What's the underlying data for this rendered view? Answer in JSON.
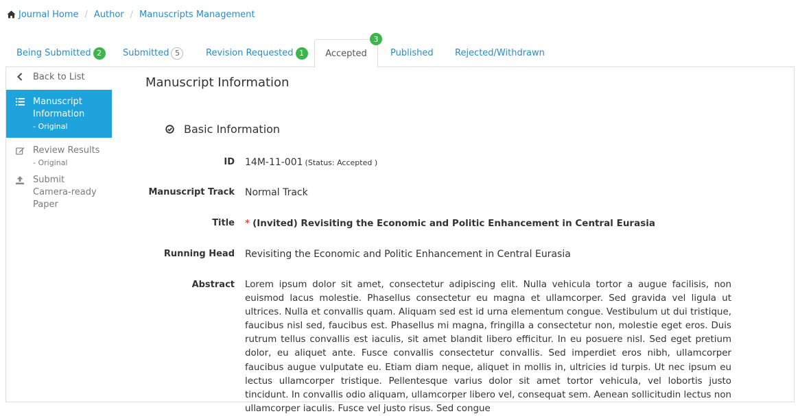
{
  "breadcrumb": {
    "items": [
      "Journal Home",
      "Author",
      "Manuscripts Management"
    ],
    "separator": "/"
  },
  "tabs": [
    {
      "label": "Being Submitted",
      "badge": "2",
      "badge_style": "green"
    },
    {
      "label": "Submitted",
      "badge": "5",
      "badge_style": "outline"
    },
    {
      "label": "Revision Requested",
      "badge": "1",
      "badge_style": "green"
    },
    {
      "label": "Accepted",
      "badge": "3",
      "badge_style": "green",
      "active": true
    },
    {
      "label": "Published"
    },
    {
      "label": "Rejected/Withdrawn"
    }
  ],
  "sidebar": {
    "back": "Back to List",
    "items": [
      {
        "label": "Manuscript Information",
        "sub": "- Original",
        "icon": "list-icon",
        "active": true
      },
      {
        "label": "Review Results",
        "sub": "- Original",
        "icon": "edit-icon"
      },
      {
        "label": "Submit Camera-ready Paper",
        "icon": "upload-icon"
      }
    ]
  },
  "main": {
    "section_title": "Manuscript Information",
    "subsection_title": "Basic Information",
    "fields": {
      "id_label": "ID",
      "id_value": "14M-11-001",
      "status_note": "(Status: Accepted )",
      "track_label": "Manuscript Track",
      "track_value": "Normal Track",
      "title_label": "Title",
      "title_required": "*",
      "title_value": "(Invited) Revisiting the Economic and Politic Enhancement in Central Eurasia",
      "running_head_label": "Running Head",
      "running_head_value": "Revisiting the Economic and Politic Enhancement in Central Eurasia",
      "abstract_label": "Abstract",
      "abstract_value": "Lorem ipsum dolor sit amet, consectetur adipiscing elit. Nulla vehicula tortor a augue facilisis, non euismod lacus molestie. Phasellus consectetur eu magna et ullamcorper. Sed gravida vel ligula ut ultrices. Nulla et convallis quam. Aliquam sed est id urna elementum congue. Vestibulum ut dui tristique, faucibus nisl sed, faucibus est. Phasellus mi magna, fringilla a consectetur non, molestie eget eros. Duis rutrum tellus convallis est iaculis, sit amet blandit libero efficitur. In eu posuere nisl. Sed eget pretium dolor, eu aliquet ante. Fusce convallis consectetur convallis. Sed imperdiet eros nibh, ullamcorper faucibus augue vulputate eu. Etiam diam neque, aliquet in mollis in, ultricies id turpis. Ut nec ipsum eu lectus ullamcorper tristique. Pellentesque varius dolor sit amet tortor vehicula, vel lobortis justo tincidunt. In convallis odio aliquam, ullamcorper libero vel, consequat sem. Aenean sollicitudin lectus non ullamcorper iaculis. Fusce vel justo risus. Sed congue"
    }
  },
  "colors": {
    "link": "#2a8cc5",
    "badge_green": "#3cb54a",
    "sidebar_active": "#1ea3dc",
    "required": "#d9534f"
  }
}
